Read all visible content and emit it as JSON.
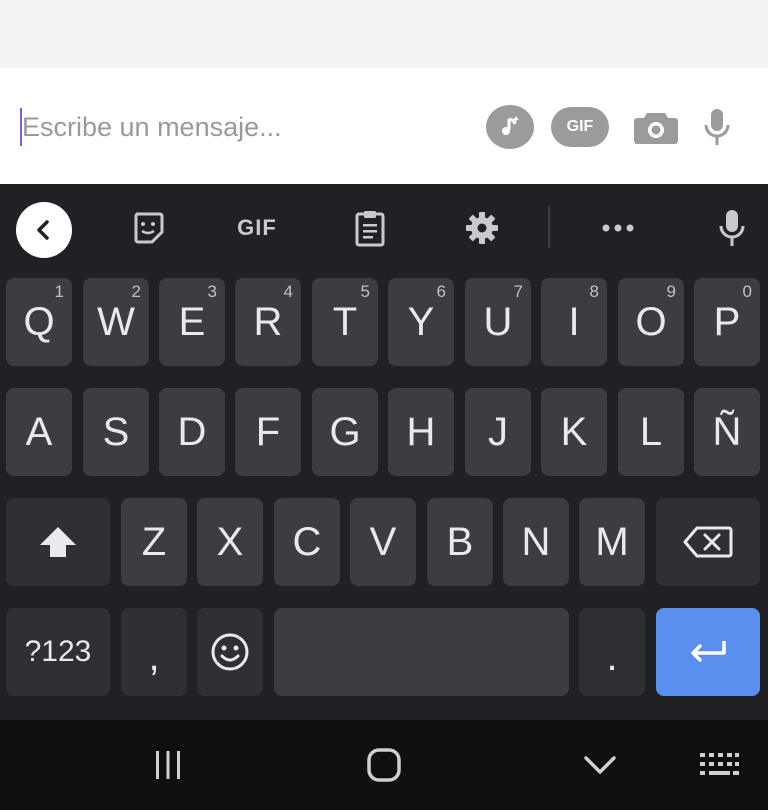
{
  "composer": {
    "placeholder": "Escribe un mensaje...",
    "buttons": [
      {
        "name": "music-icon"
      },
      {
        "name": "gif-button",
        "label": "GIF"
      },
      {
        "name": "camera-icon"
      },
      {
        "name": "microphone-icon"
      }
    ]
  },
  "keyboard": {
    "toolbar": {
      "back": "chevron-left-icon",
      "sticker": "sticker-icon",
      "gif_label": "GIF",
      "clipboard": "clipboard-icon",
      "settings": "gear-icon",
      "more": "more-horizontal-icon",
      "mic": "microphone-icon"
    },
    "row1": [
      {
        "label": "Q",
        "hint": "1"
      },
      {
        "label": "W",
        "hint": "2"
      },
      {
        "label": "E",
        "hint": "3"
      },
      {
        "label": "R",
        "hint": "4"
      },
      {
        "label": "T",
        "hint": "5"
      },
      {
        "label": "Y",
        "hint": "6"
      },
      {
        "label": "U",
        "hint": "7"
      },
      {
        "label": "I",
        "hint": "8"
      },
      {
        "label": "O",
        "hint": "9"
      },
      {
        "label": "P",
        "hint": "0"
      }
    ],
    "row2": [
      "A",
      "S",
      "D",
      "F",
      "G",
      "H",
      "J",
      "K",
      "L",
      "Ñ"
    ],
    "row3": [
      "Z",
      "X",
      "C",
      "V",
      "B",
      "N",
      "M"
    ],
    "row4": {
      "symbols_label": "?123",
      "comma_label": ",",
      "period_label": "."
    },
    "colors": {
      "background": "#202124",
      "key": "#3c3d41",
      "enter": "#5a8ff0"
    }
  },
  "navbar": {
    "items": [
      "recent-apps-icon",
      "home-icon",
      "back-chevron-icon",
      "keyboard-icon"
    ]
  }
}
